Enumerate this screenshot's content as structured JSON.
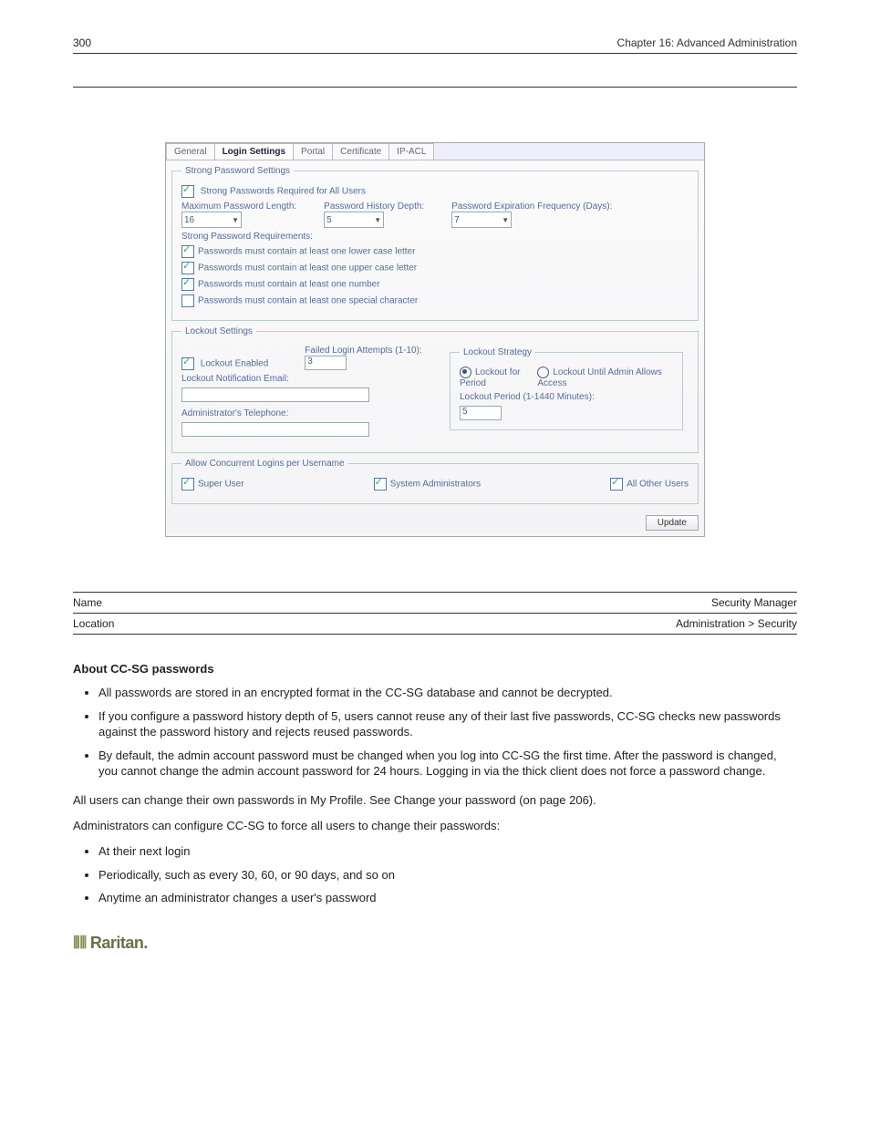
{
  "pageNumber": "300",
  "chapterTitle": "Chapter 16: Advanced Administration",
  "tabs": {
    "general": "General",
    "login": "Login Settings",
    "portal": "Portal",
    "certificate": "Certificate",
    "ipacl": "IP-ACL"
  },
  "strongPwd": {
    "legend": "Strong Password Settings",
    "requiredLabel": "Strong Passwords Required for All Users",
    "maxLenLabel": "Maximum Password Length:",
    "maxLenValue": "16",
    "histLabel": "Password History Depth:",
    "histValue": "5",
    "expLabel": "Password Expiration Frequency (Days):",
    "expValue": "7",
    "reqLabel": "Strong Password Requirements:",
    "lower": "Passwords must contain at least one lower case letter",
    "upper": "Passwords must contain at least one upper case letter",
    "number": "Passwords must contain at least one number",
    "special": "Passwords must contain at least one special character"
  },
  "lockout": {
    "legend": "Lockout Settings",
    "enabled": "Lockout Enabled",
    "failedLabel": "Failed Login Attempts (1-10):",
    "failedValue": "3",
    "emailLabel": "Lockout Notification Email:",
    "phoneLabel": "Administrator's Telephone:",
    "strategyLegend": "Lockout Strategy",
    "forPeriod": "Lockout for Period",
    "untilAdmin": "Lockout Until Admin Allows Access",
    "periodLabel": "Lockout Period (1-1440 Minutes):",
    "periodValue": "5"
  },
  "concurrent": {
    "legend": "Allow Concurrent Logins per Username",
    "super": "Super User",
    "sysadmin": "System Administrators",
    "other": "All Other Users"
  },
  "updateLabel": "Update",
  "note": {
    "name": "Name",
    "nameVal": "Security Manager",
    "loc": "Location",
    "locVal": "Administration > Security",
    "title": "About CC-SG passwords"
  },
  "bullets1": [
    "All passwords are stored in an encrypted format in the CC-SG database and cannot be decrypted.",
    "If you configure a password history depth of 5, users cannot reuse any of their last five passwords, CC-SG checks new passwords against the password history and rejects reused passwords.",
    "By default, the admin account password must be changed when you log into CC-SG the first time. After the password is changed, you cannot change the admin account password for 24 hours. Logging in via the thick client does not force a password change."
  ],
  "para1": "All users can change their own passwords in My Profile. See Change your password (on page 206).",
  "bullets2Intro": "Administrators can configure CC-SG to force all users to change their passwords:",
  "bullets2": [
    "At their next login",
    "Periodically, such as every 30, 60, or 90 days, and so on",
    "Anytime an administrator changes a user's password"
  ],
  "logoText": "Raritan."
}
